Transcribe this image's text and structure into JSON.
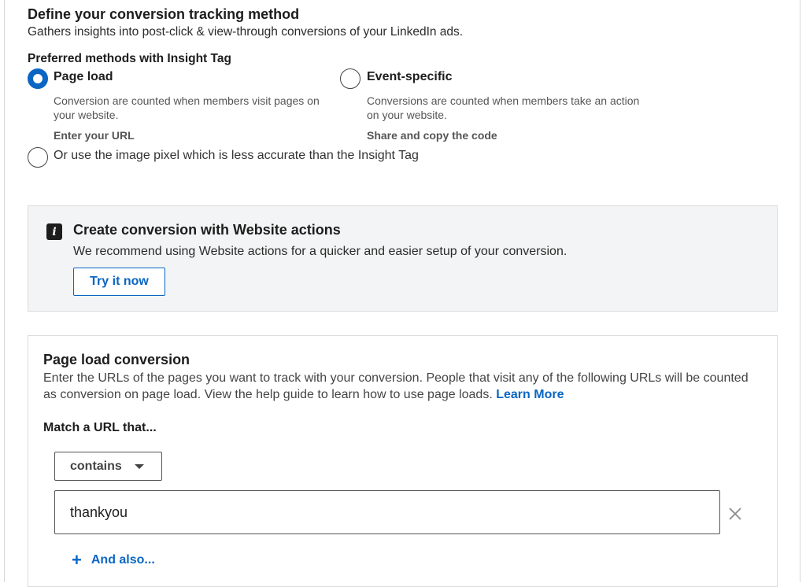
{
  "header": {
    "title": "Define your conversion tracking method",
    "subtitle": "Gathers insights into post-click & view-through conversions of your LinkedIn ads."
  },
  "methods": {
    "label": "Preferred methods with Insight Tag",
    "page_load": {
      "title": "Page load",
      "description": "Conversion are counted when members visit pages on your website.",
      "action": "Enter your URL",
      "selected": true
    },
    "event_specific": {
      "title": "Event-specific",
      "description": "Conversions are counted when members take an action on your website.",
      "action": "Share and copy the code",
      "selected": false
    },
    "image_pixel": {
      "label": "Or use the image pixel which is less accurate than the Insight Tag",
      "selected": false
    }
  },
  "info_box": {
    "icon": "info-icon",
    "title": "Create conversion with Website actions",
    "text": "We recommend using Website actions for a quicker and easier setup of your conversion.",
    "button_label": "Try it now"
  },
  "page_load_card": {
    "title": "Page load conversion",
    "description": "Enter the URLs of the pages you want to track with your conversion. People that visit any of the following URLs will be counted as conversion on page load. View the help guide to learn how to use page loads.",
    "learn_more": "Learn More",
    "match_label": "Match a URL that...",
    "match_select": "contains",
    "url_value": "thankyou",
    "add_label": "And also..."
  },
  "colors": {
    "accent": "#0a66c2",
    "info_bg": "#f3f4f5"
  }
}
